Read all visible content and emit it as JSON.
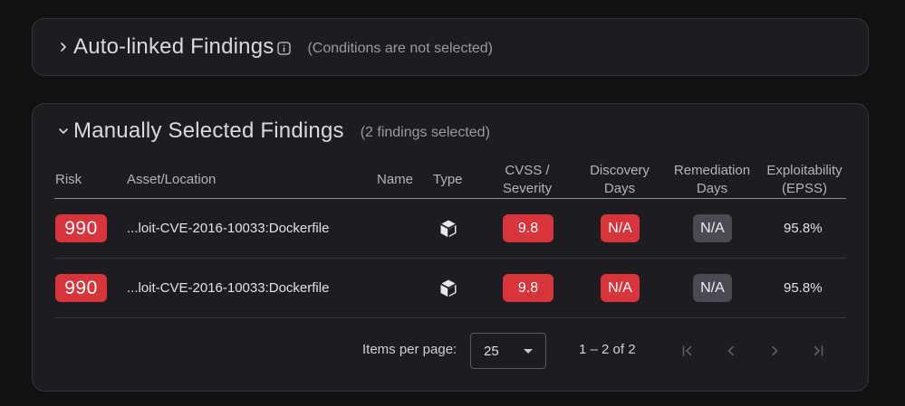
{
  "auto_linked": {
    "title": "Auto-linked Findings",
    "subtitle": "(Conditions are not selected)",
    "expanded": false
  },
  "manual": {
    "title": "Manually Selected Findings",
    "subtitle": "(2 findings selected)",
    "expanded": true
  },
  "table": {
    "columns": {
      "risk": "Risk",
      "asset": "Asset/Location",
      "name": "Name",
      "type": "Type",
      "cvss_1": "CVSS /",
      "cvss_2": "Severity",
      "discovery_1": "Discovery",
      "discovery_2": "Days",
      "remediation_1": "Remediation",
      "remediation_2": "Days",
      "epss_1": "Exploitability",
      "epss_2": "(EPSS)"
    },
    "rows": [
      {
        "risk": "990",
        "asset": "...loit-CVE-2016-10033:Dockerfile",
        "name": "",
        "type_icon": "package-icon",
        "cvss": "9.8",
        "discovery": "N/A",
        "remediation": "N/A",
        "epss": "95.8%"
      },
      {
        "risk": "990",
        "asset": "...loit-CVE-2016-10033:Dockerfile",
        "name": "",
        "type_icon": "package-icon",
        "cvss": "9.8",
        "discovery": "N/A",
        "remediation": "N/A",
        "epss": "95.8%"
      }
    ]
  },
  "paginator": {
    "items_per_page_label": "Items per page:",
    "items_per_page_value": "25",
    "range_label": "1 – 2 of 2"
  },
  "colors": {
    "critical": "#d8343c",
    "neutral_badge": "#4a4a52",
    "panel_bg": "#1c1c21",
    "page_bg": "#111114"
  }
}
